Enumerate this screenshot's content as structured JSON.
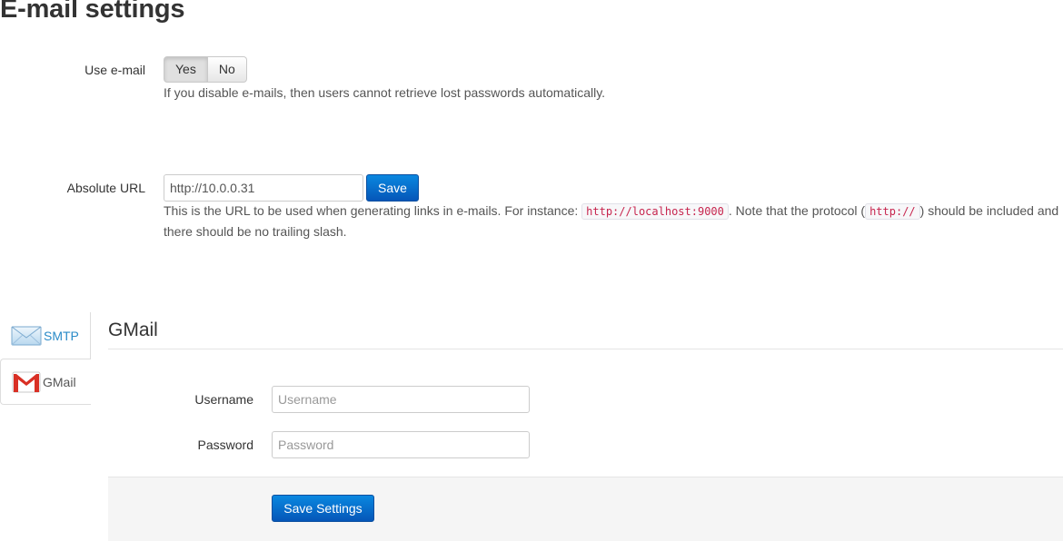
{
  "page": {
    "title": "E-mail settings"
  },
  "use_email": {
    "label": "Use e-mail",
    "options": [
      "Yes",
      "No"
    ],
    "selected": "Yes",
    "help": "If you disable e-mails, then users cannot retrieve lost passwords automatically."
  },
  "absolute_url": {
    "label": "Absolute URL",
    "value": "http://10.0.0.31",
    "save_label": "Save",
    "help_part1": "This is the URL to be used when generating links in e-mails. For instance: ",
    "help_code1": "http://localhost:9000",
    "help_part2": ". Note that the protocol (",
    "help_code2": "http://",
    "help_part3": ") should be included and there should be no trailing slash."
  },
  "tabs": [
    {
      "label": "SMTP",
      "icon": "envelope-icon",
      "active": false
    },
    {
      "label": "GMail",
      "icon": "gmail-icon",
      "active": true
    }
  ],
  "gmail": {
    "title": "GMail",
    "username_label": "Username",
    "username_placeholder": "Username",
    "password_label": "Password",
    "password_placeholder": "Password",
    "save_label": "Save Settings"
  },
  "colors": {
    "primary": "#0a6fce",
    "link": "#2a8bc8",
    "code": "#c7254e"
  }
}
